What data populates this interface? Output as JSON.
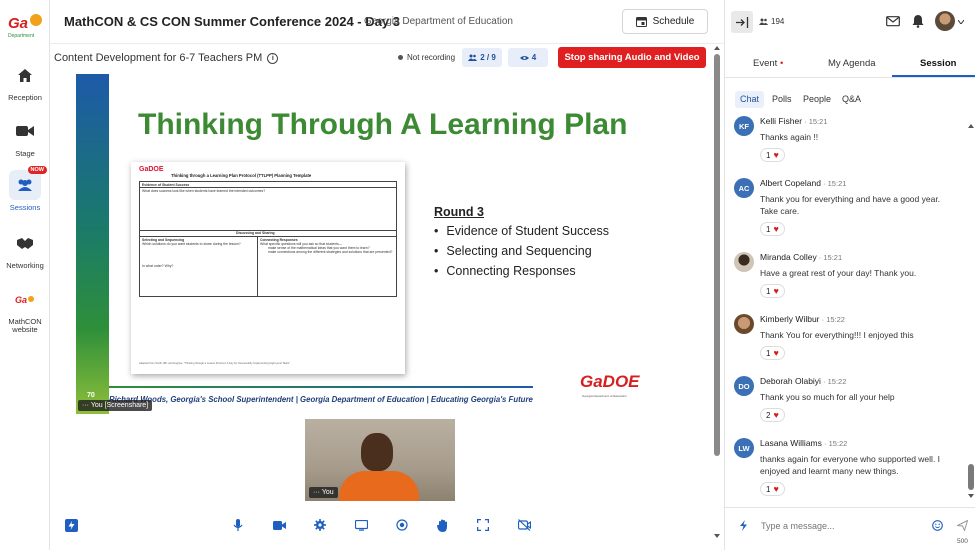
{
  "app": {
    "title": "MathCON & CS CON Summer Conference 2024 - Day 3",
    "subtitle": "Georgia Department of Education",
    "schedule_label": "Schedule",
    "logo_text": "Ga DOE"
  },
  "leftnav": {
    "items": [
      {
        "label": "Reception",
        "icon": "home-icon"
      },
      {
        "label": "Stage",
        "icon": "video-camera-icon"
      },
      {
        "label": "Sessions",
        "icon": "group-icon",
        "badge": "NOW"
      },
      {
        "label": "Networking",
        "icon": "handshake-icon"
      },
      {
        "label": "MathCON website",
        "icon": "gadoe-logo-icon"
      }
    ]
  },
  "session": {
    "name": "Content Development for 6-7 Teachers PM",
    "recording_status": "Not recording",
    "participants": "2 / 9",
    "viewers": "4",
    "stop_sharing_label": "Stop sharing Audio and Video"
  },
  "slide": {
    "title": "Thinking Through A Learning Plan",
    "doc_title": "Thinking through a Learning Plan Protocol (TTLPP) Planning Template",
    "doc_logo": "GaDOE",
    "doc_sections": {
      "evidence_title": "Evidence of Student Success",
      "evidence_text": "What does success look like when students have learned the intended outcomes?",
      "discuss_title": "Discussing and Sharing",
      "select_title": "Selecting and Sequencing",
      "select_text": "Which solutions do you want students to share during the lesson?",
      "select_order": "In what order? Why?",
      "connect_title": "Connecting Responses",
      "connect_text": "What specific questions will you ask so that students—",
      "connect_b1": "make sense of the mathematical ideas that you want them to learn?",
      "connect_b2": "make connections among the different strategies and solutions that are presented?",
      "footnote": "Adapted from Smith, Bill, and Hughes, \"Thinking through a Lesson Protocol: A Key for Successfully Implementing High-Level Tasks\""
    },
    "round_title": "Round 3",
    "bullets": [
      "Evidence of Student Success",
      "Selecting and Sequencing",
      "Connecting Responses"
    ],
    "footer": "Richard Woods, Georgia's School Superintendent | Georgia Department of Education | Educating Georgia's Future",
    "slide_number": "70",
    "screenshare_tag": "You [Screenshare]",
    "brand_logo": "GaDOE",
    "brand_sub": "Georgia Department of Education"
  },
  "webcam": {
    "tag": "You"
  },
  "right_panel": {
    "attendee_count": "194",
    "tabs": [
      "Event",
      "My Agenda",
      "Session"
    ],
    "event_dot": "•",
    "subtabs": [
      "Chat",
      "Polls",
      "People",
      "Q&A"
    ],
    "messages": [
      {
        "initials": "KF",
        "name": "Kelli Fisher",
        "time": "15:21",
        "text": "Thanks again !!",
        "reactions": "1",
        "avatar_color": "#3b6fb6"
      },
      {
        "initials": "AC",
        "name": "Albert Copeland",
        "time": "15:21",
        "text": "Thank you for everything and have a good year. Take care.",
        "reactions": "1",
        "avatar_color": "#3b6fb6"
      },
      {
        "initials": "",
        "name": "Miranda Colley",
        "time": "15:21",
        "text": "Have a great rest of your day! Thank you.",
        "reactions": "1",
        "avatar_color": "#6b5a4a"
      },
      {
        "initials": "",
        "name": "Kimberly Wilbur",
        "time": "15:22",
        "text": "Thank You for everything!!! I enjoyed this",
        "reactions": "1",
        "avatar_color": "#8a6a4a"
      },
      {
        "initials": "DO",
        "name": "Deborah Olabiyi",
        "time": "15:22",
        "text": "Thank you so much for all your help",
        "reactions": "2",
        "avatar_color": "#3b6fb6"
      },
      {
        "initials": "LW",
        "name": "Lasana Williams",
        "time": "15:22",
        "text": "thanks again for everyone who supported well. I enjoyed and learnt many new things.",
        "reactions": "1",
        "avatar_color": "#3b6fb6"
      }
    ],
    "input_placeholder": "Type a message...",
    "char_limit": "500"
  }
}
